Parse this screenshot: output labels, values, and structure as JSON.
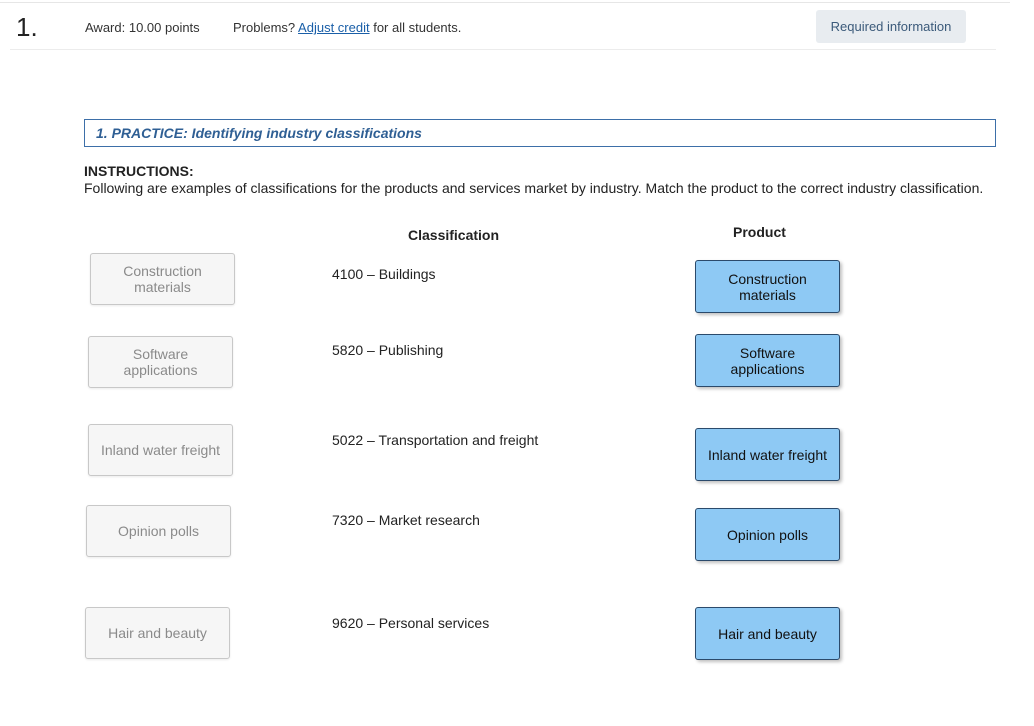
{
  "header": {
    "question_number": "1.",
    "award": "Award: 10.00 points",
    "problems_prefix": "Problems?",
    "adjust_credit": "Adjust credit",
    "problems_suffix": "for all students.",
    "required_info": "Required information"
  },
  "practice": {
    "title": "1. PRACTICE: Identifying industry classifications",
    "instructions_heading": "INSTRUCTIONS:",
    "instructions_text": "Following are examples of classifications for the products and services market by industry. Match the product to the correct industry classification."
  },
  "columns": {
    "classification": "Classification",
    "product": "Product"
  },
  "source_items": [
    "Construction materials",
    "Software applications",
    "Inland water freight",
    "Opinion polls",
    "Hair and beauty"
  ],
  "classifications": [
    "4100 – Buildings",
    "5820 – Publishing",
    "5022 – Transportation and freight",
    "7320 – Market research",
    "9620 – Personal services"
  ],
  "placed_products": [
    "Construction materials",
    "Software applications",
    "Inland water freight",
    "Opinion polls",
    "Hair and beauty"
  ]
}
